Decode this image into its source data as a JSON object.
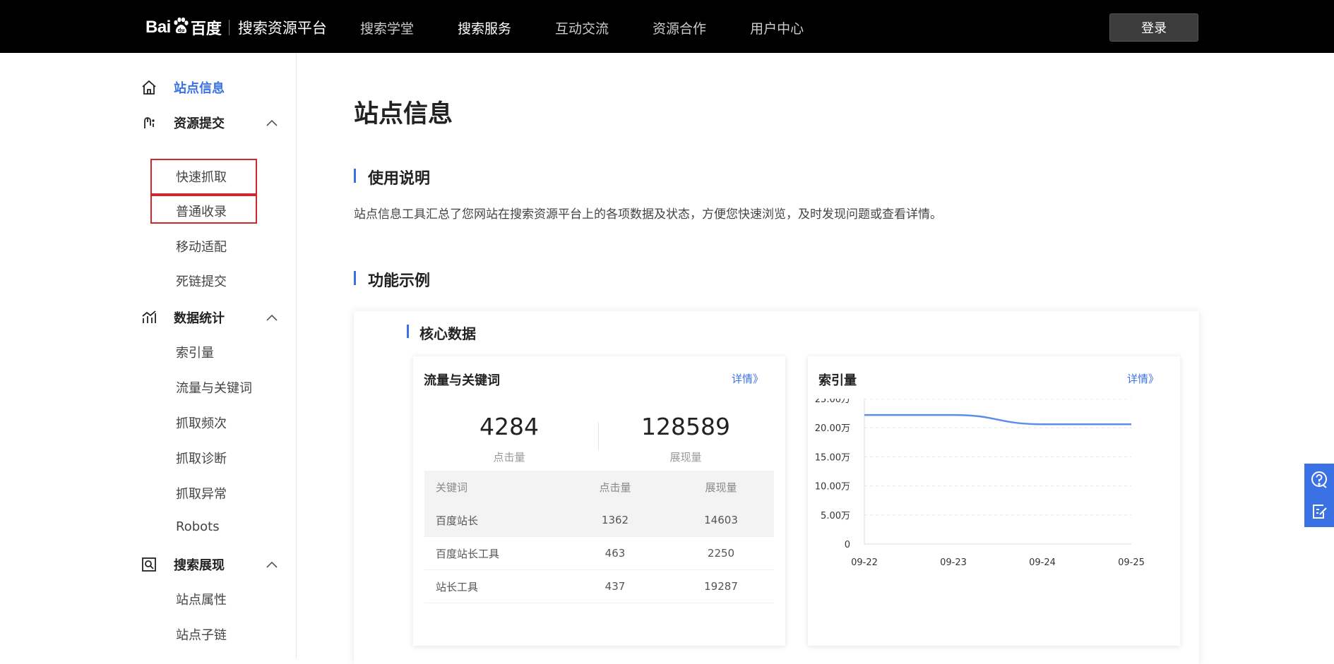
{
  "header": {
    "logo_bai": "Bai",
    "logo_du": "百度",
    "platform": "搜索资源平台",
    "nav": [
      "搜索学堂",
      "搜索服务",
      "互动交流",
      "资源合作",
      "用户中心"
    ],
    "active_nav": "搜索服务",
    "login": "登录"
  },
  "sidebar": {
    "site_info": "站点信息",
    "resource_submit": {
      "label": "资源提交",
      "items": [
        "快速抓取",
        "普通收录",
        "移动适配",
        "死链提交"
      ]
    },
    "data_stats": {
      "label": "数据统计",
      "items": [
        "索引量",
        "流量与关键词",
        "抓取频次",
        "抓取诊断",
        "抓取异常",
        "Robots"
      ]
    },
    "search_display": {
      "label": "搜索展现",
      "items": [
        "站点属性",
        "站点子链"
      ]
    }
  },
  "main": {
    "title": "站点信息",
    "usage_title": "使用说明",
    "usage_desc": "站点信息工具汇总了您网站在搜索资源平台上的各项数据及状态，方便您快速浏览，及时发现问题或查看详情。",
    "example_title": "功能示例",
    "core_title": "核心数据",
    "traffic_card": {
      "title": "流量与关键词",
      "link": "详情》",
      "clicks": "4284",
      "clicks_label": "点击量",
      "impressions": "128589",
      "impressions_label": "展现量",
      "table_headers": [
        "关键词",
        "点击量",
        "展现量"
      ],
      "rows": [
        [
          "百度站长",
          "1362",
          "14603"
        ],
        [
          "百度站长工具",
          "463",
          "2250"
        ],
        [
          "站长工具",
          "437",
          "19287"
        ]
      ]
    },
    "index_card": {
      "title": "索引量",
      "link": "详情》"
    }
  },
  "chart_data": {
    "type": "line",
    "title": "",
    "x": [
      "09-22",
      "09-23",
      "09-24",
      "09-25"
    ],
    "yticks": [
      "0",
      "5.00万",
      "10.00万",
      "15.00万",
      "20.00万",
      "25.00万"
    ],
    "ylim": [
      0,
      250000
    ],
    "series": [
      {
        "values": [
          222000,
          222000,
          206000,
          206000
        ]
      }
    ],
    "color": "#5b8ee8",
    "grid": true
  }
}
